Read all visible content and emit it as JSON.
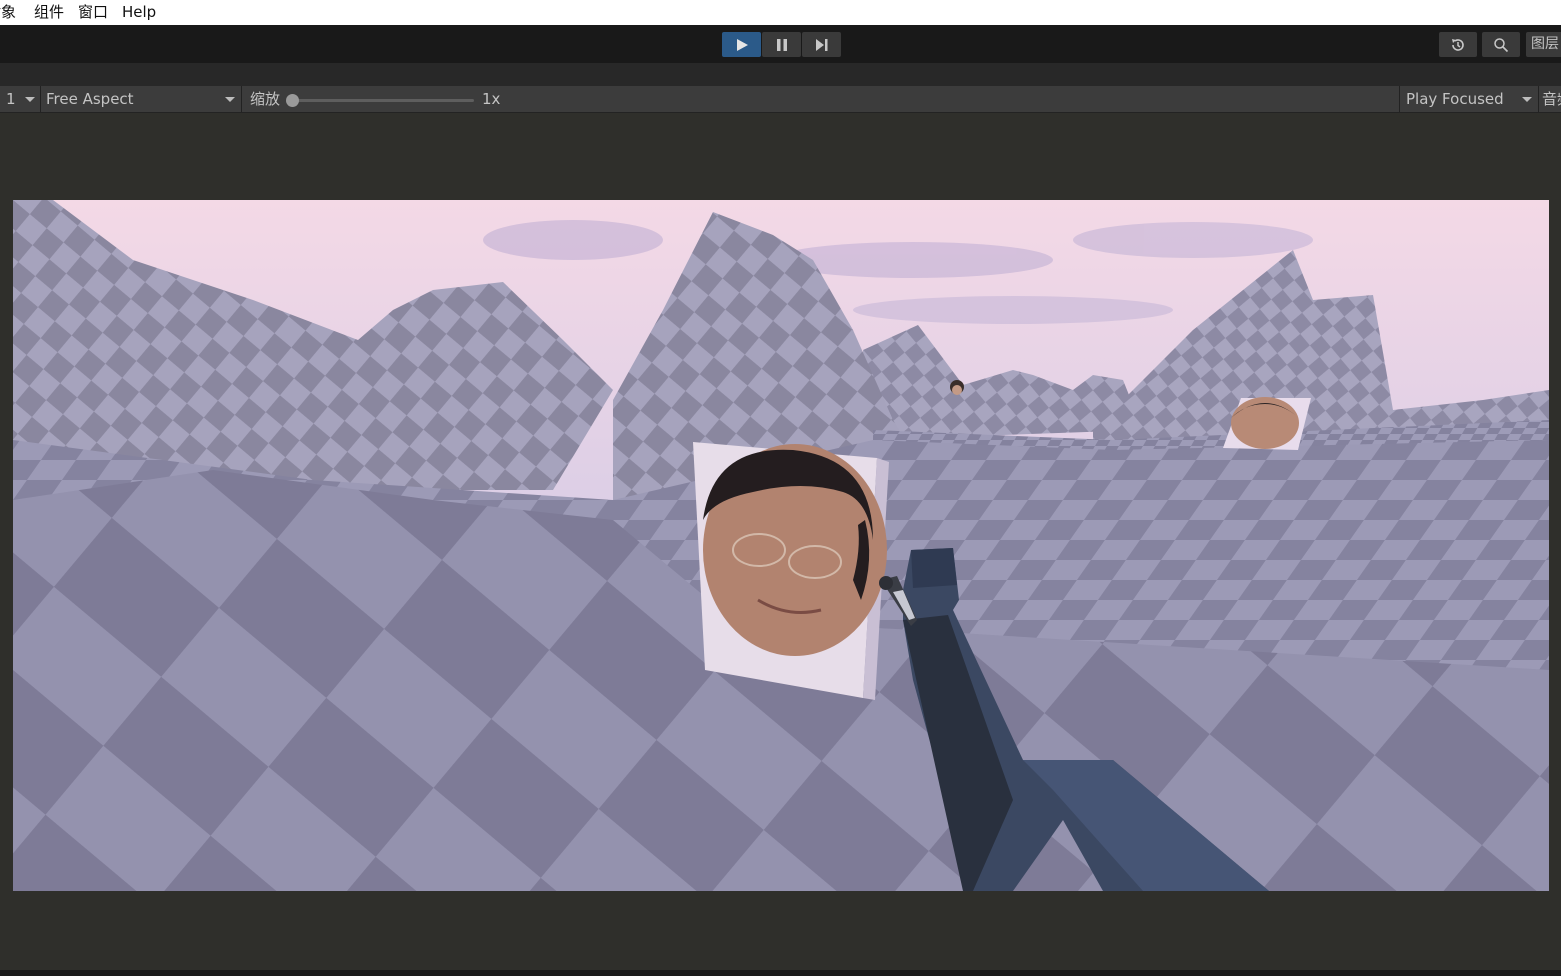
{
  "menu": {
    "items": [
      {
        "label": "对象"
      },
      {
        "label": "组件"
      },
      {
        "label": "窗口"
      },
      {
        "label": "Help"
      }
    ]
  },
  "toolbar": {
    "play_state": "playing",
    "play_label": "Play",
    "pause_label": "Pause",
    "step_label": "Step",
    "history_label": "History",
    "search_label": "Search",
    "layers_label": "图层"
  },
  "game_view": {
    "display": "1",
    "aspect": "Free Aspect",
    "scale_label": "缩放",
    "scale_value": "1x",
    "scale_fraction": 0.0,
    "play_mode": "Play Focused",
    "audio_label": "音频"
  },
  "scene": {
    "description": "First-person game view: lavender checkerboard mountainous terrain under pink-purple cloudy sky, face-textured target cubes, and a dark blue rifle in the lower right",
    "targets": [
      {
        "name": "near-face-target"
      },
      {
        "name": "far-face-target-right"
      },
      {
        "name": "far-face-target-center"
      }
    ],
    "colors": {
      "sky_top": "#f3d8e6",
      "sky_bottom": "#c9c8e6",
      "terrain_light": "#9a98b4",
      "terrain_dark": "#7f7c98",
      "gun": "#3d4a64",
      "play_active": "#2b5a89"
    }
  }
}
